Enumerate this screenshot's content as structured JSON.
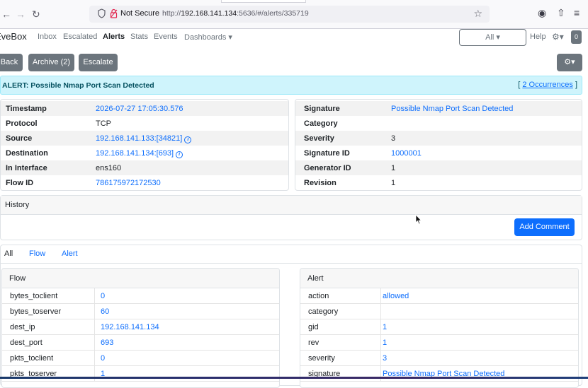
{
  "browser": {
    "not_secure": "Not Secure",
    "url_prefix": "http://",
    "url_host": "192.168.141.134",
    "url_rest": ":5636/#/alerts/335719"
  },
  "navbar": {
    "brand": "EveBox",
    "items": [
      "Inbox",
      "Escalated",
      "Alerts",
      "Stats",
      "Events",
      "Dashboards ▾"
    ],
    "all_label": "All ▾",
    "help_label": "Help",
    "badge": "0"
  },
  "actions": {
    "back": "Back",
    "archive": "Archive (2)",
    "escalate": "Escalate"
  },
  "banner": {
    "title": "ALERT: Possible Nmap Port Scan Detected",
    "occ_open": "[",
    "occ_link": "2 Occurrences",
    "occ_close": "]"
  },
  "left_info": [
    {
      "key": "Timestamp",
      "value": "2026-07-27 17:05:30.576",
      "link": true
    },
    {
      "key": "Protocol",
      "value": "TCP",
      "link": false
    },
    {
      "key": "Source",
      "value": "192.168.141.133:[34821]",
      "link": true,
      "info": true
    },
    {
      "key": "Destination",
      "value": "192.168.141.134:[693]",
      "link": true,
      "info": true
    },
    {
      "key": "In Interface",
      "value": "ens160",
      "link": false
    },
    {
      "key": "Flow ID",
      "value": "786175972172530",
      "link": true
    }
  ],
  "right_info": [
    {
      "key": "Signature",
      "value": "Possible Nmap Port Scan Detected",
      "link": true
    },
    {
      "key": "Category",
      "value": "",
      "link": false
    },
    {
      "key": "Severity",
      "value": "3",
      "link": false
    },
    {
      "key": "Signature ID",
      "value": "1000001",
      "link": true
    },
    {
      "key": "Generator ID",
      "value": "1",
      "link": false
    },
    {
      "key": "Revision",
      "value": "1",
      "link": false
    }
  ],
  "history": {
    "title": "History",
    "add_comment": "Add Comment"
  },
  "tabs": [
    "All",
    "Flow",
    "Alert"
  ],
  "flow_table": {
    "title": "Flow",
    "rows": [
      [
        "bytes_toclient",
        "0"
      ],
      [
        "bytes_toserver",
        "60"
      ],
      [
        "dest_ip",
        "192.168.141.134"
      ],
      [
        "dest_port",
        "693"
      ],
      [
        "pkts_toclient",
        "0"
      ],
      [
        "pkts_toserver",
        "1"
      ]
    ]
  },
  "alert_table": {
    "title": "Alert",
    "rows": [
      [
        "action",
        "allowed"
      ],
      [
        "category",
        ""
      ],
      [
        "gid",
        "1"
      ],
      [
        "rev",
        "1"
      ],
      [
        "severity",
        "3"
      ],
      [
        "signature",
        "Possible Nmap Port Scan Detected"
      ]
    ]
  },
  "colors": {
    "primary": "#0d6efd",
    "secondary": "#6c757d",
    "banner_bg": "#cff4fc"
  }
}
